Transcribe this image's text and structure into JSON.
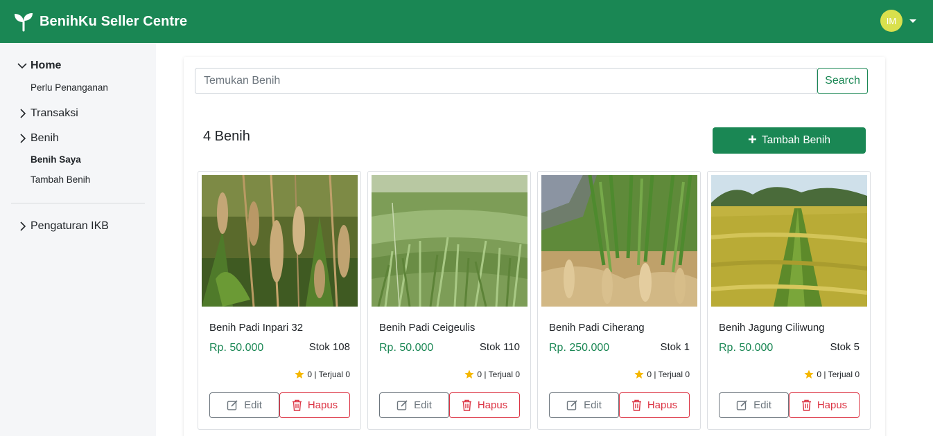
{
  "header": {
    "brand": "BenihKu Seller Centre",
    "avatar_initials": "IM",
    "colors": {
      "primary": "#1a8754",
      "avatar": "#d9e04d"
    }
  },
  "sidebar": {
    "home": {
      "label": "Home",
      "items": [
        {
          "label": "Perlu Penanganan"
        }
      ]
    },
    "transaksi": {
      "label": "Transaksi"
    },
    "benih": {
      "label": "Benih",
      "items": [
        {
          "label": "Benih Saya",
          "active": true
        },
        {
          "label": "Tambah Benih"
        }
      ]
    },
    "pengaturan": {
      "label": "Pengaturan IKB"
    }
  },
  "search": {
    "placeholder": "Temukan Benih",
    "value": "",
    "button": "Search"
  },
  "listing": {
    "count_label": "4 Benih",
    "add_button": "Tambah Benih",
    "products": [
      {
        "name": "Benih Padi Inpari 32",
        "price": "Rp. 50.000",
        "stock": "Stok 108",
        "rating": "0 | Terjual 0",
        "edit": "Edit",
        "delete": "Hapus",
        "image": "mature-rice-panicles"
      },
      {
        "name": "Benih Padi Ceigeulis",
        "price": "Rp. 50.000",
        "stock": "Stok 110",
        "rating": "0 | Terjual 0",
        "edit": "Edit",
        "delete": "Hapus",
        "image": "young-rice-field"
      },
      {
        "name": "Benih Padi Ciherang",
        "price": "Rp. 250.000",
        "stock": "Stok 1",
        "rating": "0 | Terjual 0",
        "edit": "Edit",
        "delete": "Hapus",
        "image": "ripening-rice-mountains"
      },
      {
        "name": "Benih Jagung Ciliwung",
        "price": "Rp. 50.000",
        "stock": "Stok 5",
        "rating": "0 | Terjual 0",
        "edit": "Edit",
        "delete": "Hapus",
        "image": "golden-paddy-field"
      }
    ]
  }
}
